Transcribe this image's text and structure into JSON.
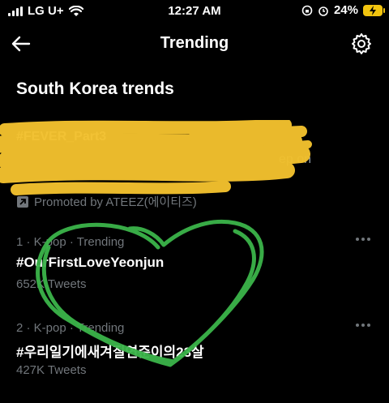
{
  "status": {
    "carrier": "LG U+",
    "time": "12:27 AM",
    "battery": "24%"
  },
  "nav": {
    "title": "Trending",
    "back_icon": "arrow-left-icon",
    "settings_icon": "gear-icon"
  },
  "section_title": "South Korea trends",
  "promoted": {
    "hashtag": "#FEVER_Part3",
    "desc_tail": "ep on",
    "label": "Promoted by ATEEZ(에이티즈)"
  },
  "trends": [
    {
      "meta": "1 · K-pop · Trending",
      "name": "#OurFirstLoveYeonjun",
      "count": "652K Tweets"
    },
    {
      "meta": "2 · K-pop · Trending",
      "name": "#우리일기에새겨질연준이의23살",
      "count": "427K Tweets"
    }
  ],
  "colors": {
    "scribble_yellow": "#f2c12e",
    "scribble_green": "#3bb54a"
  }
}
